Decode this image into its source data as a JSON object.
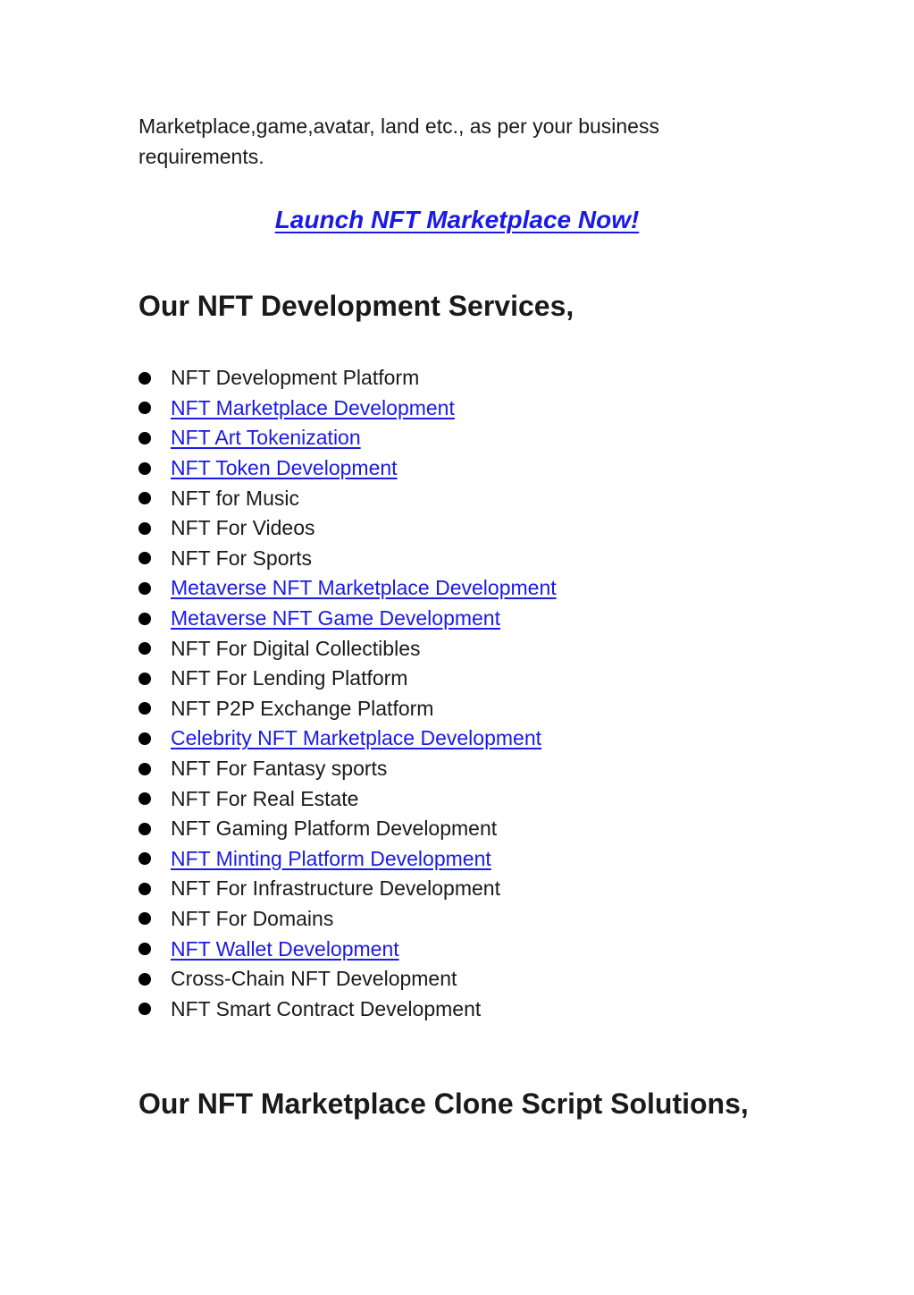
{
  "intro": {
    "line1": "Marketplace,game,avatar, land etc., as per your business",
    "line2": "requirements."
  },
  "cta": {
    "label": "Launch NFT Marketplace Now!"
  },
  "sections": {
    "services_heading": "Our NFT Development Services,",
    "clone_heading": "Our NFT Marketplace Clone Script Solutions,"
  },
  "services": [
    {
      "label": "NFT Development Platform",
      "link": false
    },
    {
      "label": "NFT Marketplace Development",
      "link": true
    },
    {
      "label": "NFT Art Tokenization",
      "link": true
    },
    {
      "label": "NFT Token Development",
      "link": true
    },
    {
      "label": "NFT for Music",
      "link": false
    },
    {
      "label": "NFT For Videos",
      "link": false
    },
    {
      "label": "NFT For Sports",
      "link": false
    },
    {
      "label": "Metaverse NFT Marketplace Development",
      "link": true
    },
    {
      "label": "Metaverse NFT Game Development",
      "link": true
    },
    {
      "label": "NFT For Digital Collectibles",
      "link": false
    },
    {
      "label": "NFT For Lending Platform",
      "link": false
    },
    {
      "label": "NFT P2P Exchange Platform",
      "link": false
    },
    {
      "label": "Celebrity NFT Marketplace Development",
      "link": true
    },
    {
      "label": "NFT For Fantasy sports",
      "link": false
    },
    {
      "label": "NFT For Real Estate",
      "link": false
    },
    {
      "label": "NFT Gaming Platform Development",
      "link": false
    },
    {
      "label": "NFT Minting Platform Development",
      "link": true
    },
    {
      "label": "NFT For Infrastructure Development",
      "link": false
    },
    {
      "label": "NFT For Domains",
      "link": false
    },
    {
      "label": "NFT Wallet Development",
      "link": true
    },
    {
      "label": "Cross-Chain NFT Development",
      "link": false
    },
    {
      "label": "NFT Smart Contract Development",
      "link": false
    }
  ],
  "colors": {
    "link": "#1a1ae6",
    "text": "#1a1a1a",
    "bullet": "#000000"
  }
}
